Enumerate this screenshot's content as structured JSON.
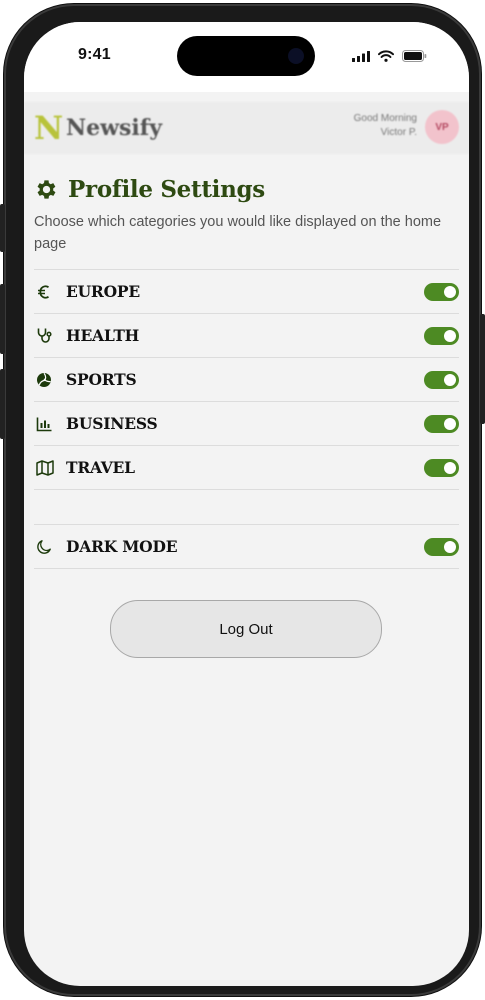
{
  "status_bar": {
    "time": "9:41"
  },
  "header": {
    "logo_letter": "N",
    "brand": "Newsify",
    "greeting_line1": "Good Morning",
    "greeting_line2": "Victor P.",
    "avatar_initials": "VP"
  },
  "page": {
    "title": "Profile Settings",
    "subtitle": "Choose which categories you would like displayed on the home page"
  },
  "categories": [
    {
      "label": "EUROPE",
      "icon": "euro-icon",
      "enabled": true
    },
    {
      "label": "HEALTH",
      "icon": "stethoscope-icon",
      "enabled": true
    },
    {
      "label": "SPORTS",
      "icon": "volleyball-icon",
      "enabled": true
    },
    {
      "label": "BUSINESS",
      "icon": "bar-chart-icon",
      "enabled": true
    },
    {
      "label": "TRAVEL",
      "icon": "map-icon",
      "enabled": true
    }
  ],
  "dark_mode": {
    "label": "DARK MODE",
    "icon": "moon-icon",
    "enabled": true
  },
  "logout_label": "Log Out",
  "colors": {
    "accent": "#4d8a23",
    "title": "#2e4a12",
    "avatar_bg": "#f2c3cc"
  }
}
